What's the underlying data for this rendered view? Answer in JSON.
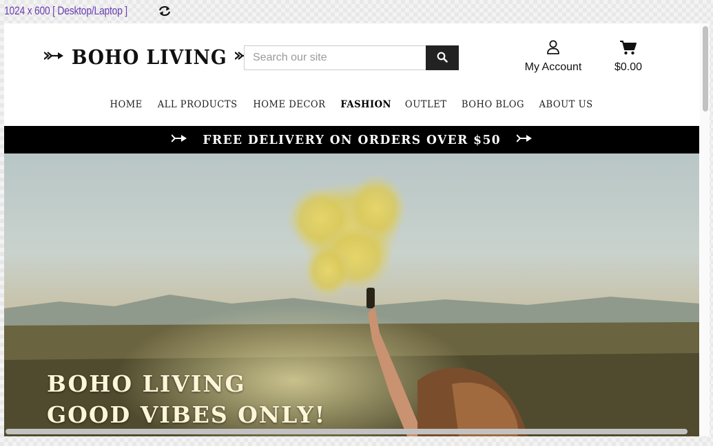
{
  "viewport_label": "1024 x 600 [ Desktop/Laptop ]",
  "brand": {
    "logo_text": "BOHO LIVING"
  },
  "search": {
    "placeholder": "Search our site",
    "value": ""
  },
  "account": {
    "label": "My Account"
  },
  "cart": {
    "total": "$0.00"
  },
  "nav": {
    "items": [
      {
        "label": "HOME"
      },
      {
        "label": "ALL PRODUCTS"
      },
      {
        "label": "HOME DECOR"
      },
      {
        "label": "FASHION"
      },
      {
        "label": "OUTLET"
      },
      {
        "label": "BOHO BLOG"
      },
      {
        "label": "ABOUT US"
      }
    ]
  },
  "promo": {
    "text": "FREE DELIVERY ON ORDERS OVER $50"
  },
  "hero": {
    "line1": "BOHO LIVING",
    "line2": "GOOD VIBES ONLY!"
  },
  "colors": {
    "label_purple": "#6a3fb0",
    "promo_bg": "#000000",
    "hero_text": "#fff6d8",
    "search_button": "#222222"
  },
  "icons": [
    "rotate-icon",
    "arrow-left-icon",
    "arrow-right-icon",
    "search-icon",
    "user-icon",
    "cart-icon"
  ]
}
